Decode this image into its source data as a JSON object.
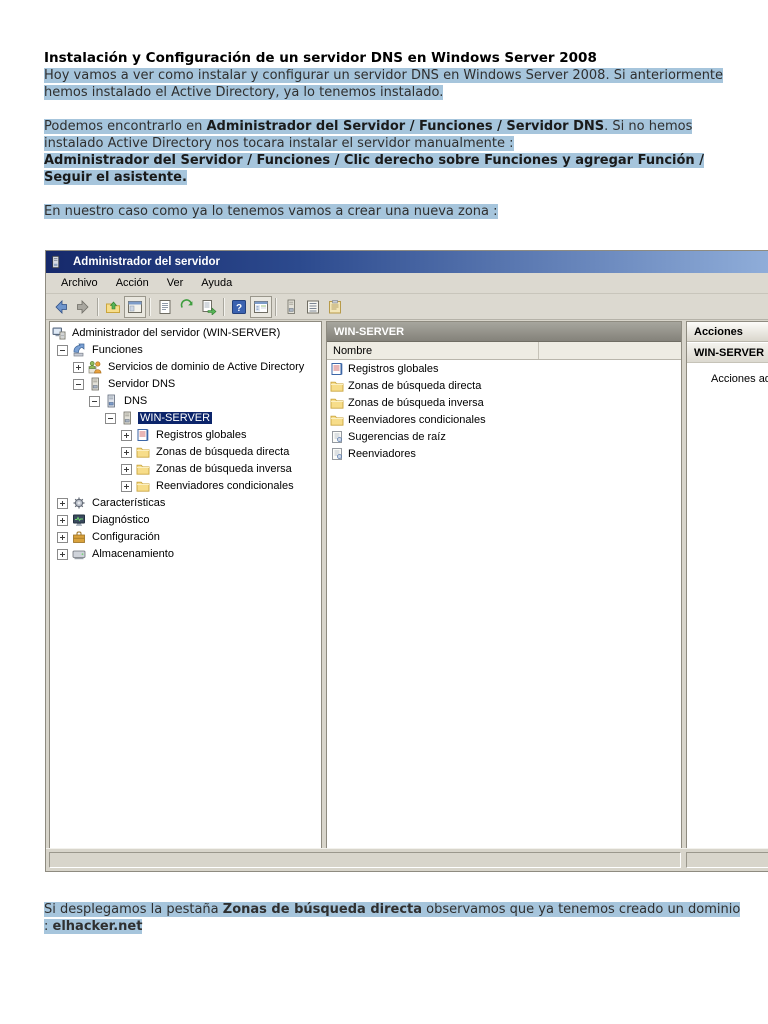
{
  "doc": {
    "title": "Instalación y Configuración de un servidor DNS en Windows Server 2008",
    "intro": "Hoy vamos a ver como instalar y configurar un servidor DNS en Windows Server 2008. Si anteriormente hemos instalado el Active Directory, ya lo tenemos instalado.",
    "find": {
      "pre": "Podemos encontrarlo en ",
      "bold": "Administrador del Servidor / Funciones / Servidor DNS",
      "post": ". Si no hemos instalado Active Directory nos tocara instalar el servidor manualmente :"
    },
    "manual_bold": "Administrador del Servidor / Funciones / Clic derecho sobre Funciones y agregar Función / Seguir el asistente.",
    "case_line": "En nuestro caso como ya lo tenemos vamos a crear una nueva zona :",
    "bottom": {
      "pre": "Si desplegamos la pestaña ",
      "bold": "Zonas de búsqueda directa",
      "post": " observamos que ya tenemos creado un dominio",
      "line2_pre": ": ",
      "domain": "elhacker.net"
    }
  },
  "win": {
    "title": "Administrador del servidor",
    "menu": [
      "Archivo",
      "Acción",
      "Ver",
      "Ayuda"
    ],
    "tree": {
      "items": [
        {
          "label": "Administrador del servidor (WIN-SERVER)"
        },
        {
          "label": "Funciones"
        },
        {
          "label": "Servicios de dominio de Active Directory"
        },
        {
          "label": "Servidor DNS"
        },
        {
          "label": "DNS"
        },
        {
          "label": "WIN-SERVER",
          "selected": true
        },
        {
          "label": "Registros globales"
        },
        {
          "label": "Zonas de búsqueda directa"
        },
        {
          "label": "Zonas de búsqueda inversa"
        },
        {
          "label": "Reenviadores condicionales"
        },
        {
          "label": "Características"
        },
        {
          "label": "Diagnóstico"
        },
        {
          "label": "Configuración"
        },
        {
          "label": "Almacenamiento"
        }
      ]
    },
    "center": {
      "header": "WIN-SERVER",
      "column": "Nombre",
      "items": [
        {
          "label": "Registros globales"
        },
        {
          "label": "Zonas de búsqueda directa"
        },
        {
          "label": "Zonas de búsqueda inversa"
        },
        {
          "label": "Reenviadores condicionales"
        },
        {
          "label": "Sugerencias de raíz"
        },
        {
          "label": "Reenviadores"
        }
      ]
    },
    "actions": {
      "header": "Acciones",
      "subheader": "WIN-SERVER",
      "more_actions": "Acciones adicionales"
    }
  },
  "colors": {
    "highlight": "#a6c5dc",
    "titlebar_left": "#16296b",
    "titlebar_right": "#8fadd9",
    "selection": "#0b246a"
  }
}
